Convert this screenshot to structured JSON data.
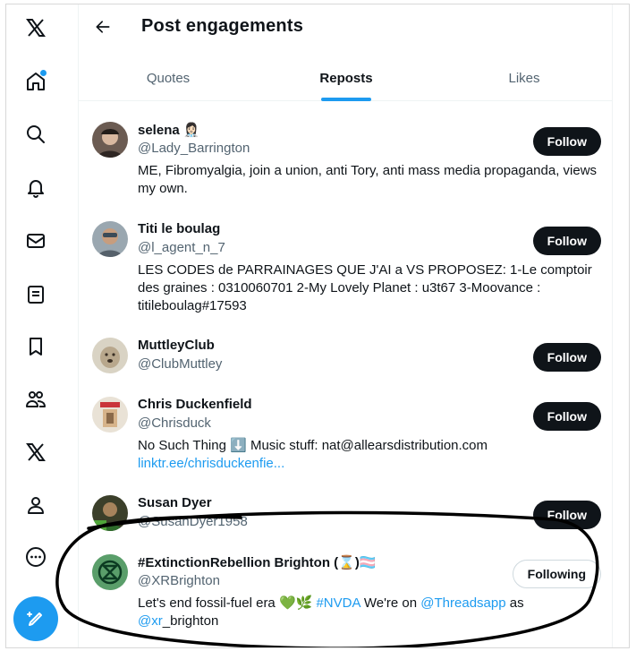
{
  "header": {
    "title": "Post engagements"
  },
  "tabs": [
    {
      "label": "Quotes",
      "active": false
    },
    {
      "label": "Reposts",
      "active": true
    },
    {
      "label": "Likes",
      "active": false
    }
  ],
  "sidebar": {
    "icons": [
      "x-logo-icon",
      "home-icon",
      "search-icon",
      "notifications-icon",
      "messages-icon",
      "lists-icon",
      "bookmarks-icon",
      "communities-icon",
      "premium-x-icon",
      "profile-icon",
      "more-icon"
    ],
    "compose_icon": "compose-post-icon"
  },
  "users": [
    {
      "name": "selena 👩🏻‍⚕️",
      "handle": "@Lady_Barrington",
      "bio": "ME, Fibromyalgia, join a union, anti Tory, anti mass media propaganda, views my own.",
      "button": "Follow"
    },
    {
      "name": "Titi le boulag",
      "handle": "@l_agent_n_7",
      "bio": "LES CODES de PARRAINAGES QUE J'AI a VS PROPOSEZ: 1-Le comptoir des graines : 0310060701 2-My Lovely Planet : u3t67 3-Moovance : titileboulag#17593",
      "button": "Follow"
    },
    {
      "name": "MuttleyClub",
      "handle": "@ClubMuttley",
      "bio": "",
      "button": "Follow"
    },
    {
      "name": "Chris Duckenfield",
      "handle": "@Chrisduck",
      "bio_text": "No Such Thing ⬇️ Music stuff: nat@allearsdistribution.com",
      "bio_link": "linktr.ee/chrisduckenfie...",
      "button": "Follow"
    },
    {
      "name": "Susan Dyer",
      "handle": "@SusanDyer1958",
      "bio": "",
      "button": "Follow"
    },
    {
      "name": "#ExtinctionRebellion Brighton (⌛)🏳️‍⚧️",
      "handle": "@XRBrighton",
      "bio_pre": "Let's end fossil-fuel era 💚🌿 ",
      "bio_tag": "#NVDA",
      "bio_mid": " We're on ",
      "bio_mention1": "@Threadsapp",
      "bio_mid2": " as ",
      "bio_mention2": "@xr",
      "bio_post": "_brighton",
      "button": "Following"
    }
  ],
  "colors": {
    "accent": "#1d9bf0",
    "text": "#0f1419",
    "muted": "#536471",
    "marker": "#000000"
  }
}
